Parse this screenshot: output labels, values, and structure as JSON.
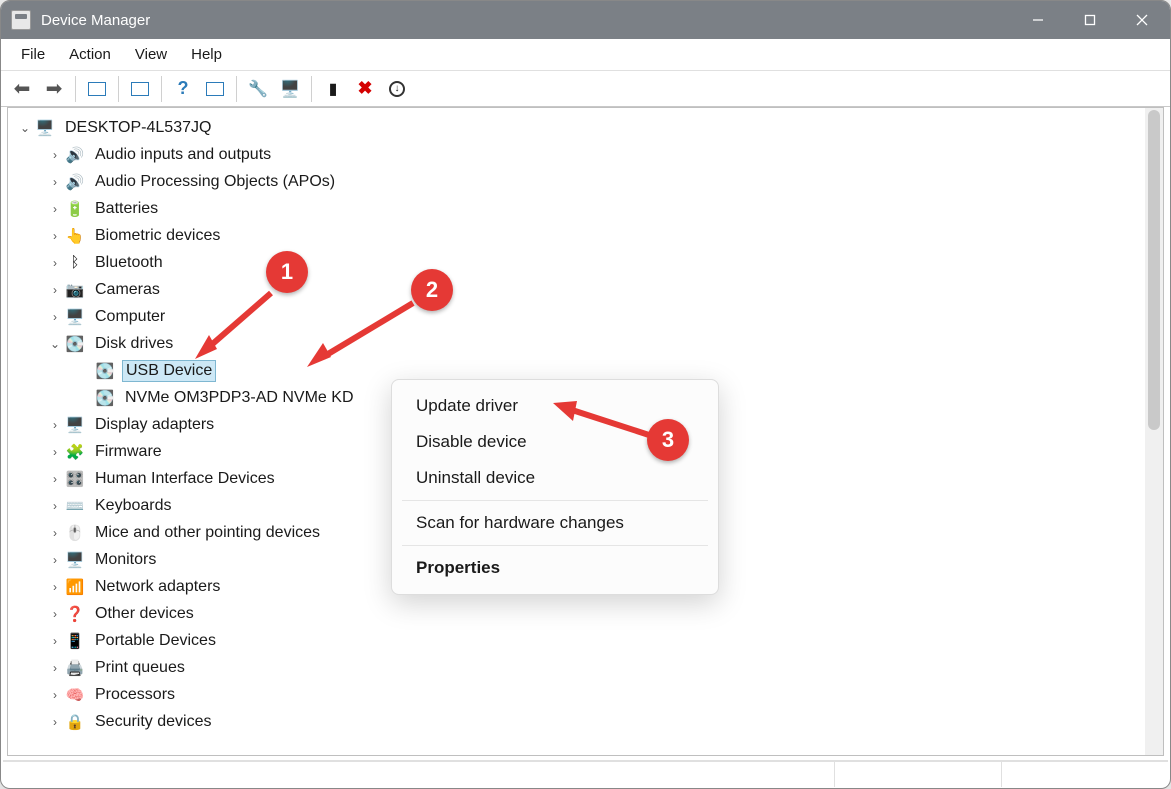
{
  "window": {
    "title": "Device Manager"
  },
  "menu": {
    "file": "File",
    "action": "Action",
    "view": "View",
    "help": "Help"
  },
  "tree": {
    "root": "DESKTOP-4L537JQ",
    "items": [
      {
        "label": "Audio inputs and outputs",
        "icon": "🔊"
      },
      {
        "label": "Audio Processing Objects (APOs)",
        "icon": "🔊"
      },
      {
        "label": "Batteries",
        "icon": "🔋"
      },
      {
        "label": "Biometric devices",
        "icon": "👆"
      },
      {
        "label": "Bluetooth",
        "icon": "ᛒ"
      },
      {
        "label": "Cameras",
        "icon": "📷"
      },
      {
        "label": "Computer",
        "icon": "🖥️"
      },
      {
        "label": "Disk drives",
        "icon": "💽",
        "open": true,
        "children": [
          {
            "label": "USB Device",
            "icon": "💽",
            "selected": true
          },
          {
            "label": "NVMe OM3PDP3-AD NVMe KD",
            "icon": "💽"
          }
        ]
      },
      {
        "label": "Display adapters",
        "icon": "🖥️"
      },
      {
        "label": "Firmware",
        "icon": "🧩"
      },
      {
        "label": "Human Interface Devices",
        "icon": "🎛️"
      },
      {
        "label": "Keyboards",
        "icon": "⌨️"
      },
      {
        "label": "Mice and other pointing devices",
        "icon": "🖱️"
      },
      {
        "label": "Monitors",
        "icon": "🖥️"
      },
      {
        "label": "Network adapters",
        "icon": "📶"
      },
      {
        "label": "Other devices",
        "icon": "❓"
      },
      {
        "label": "Portable Devices",
        "icon": "📱"
      },
      {
        "label": "Print queues",
        "icon": "🖨️"
      },
      {
        "label": "Processors",
        "icon": "🧠"
      },
      {
        "label": "Security devices",
        "icon": "🔒"
      }
    ]
  },
  "context_menu": {
    "update": "Update driver",
    "disable": "Disable device",
    "uninstall": "Uninstall device",
    "scan": "Scan for hardware changes",
    "properties": "Properties"
  },
  "annotations": {
    "a1": "1",
    "a2": "2",
    "a3": "3"
  }
}
